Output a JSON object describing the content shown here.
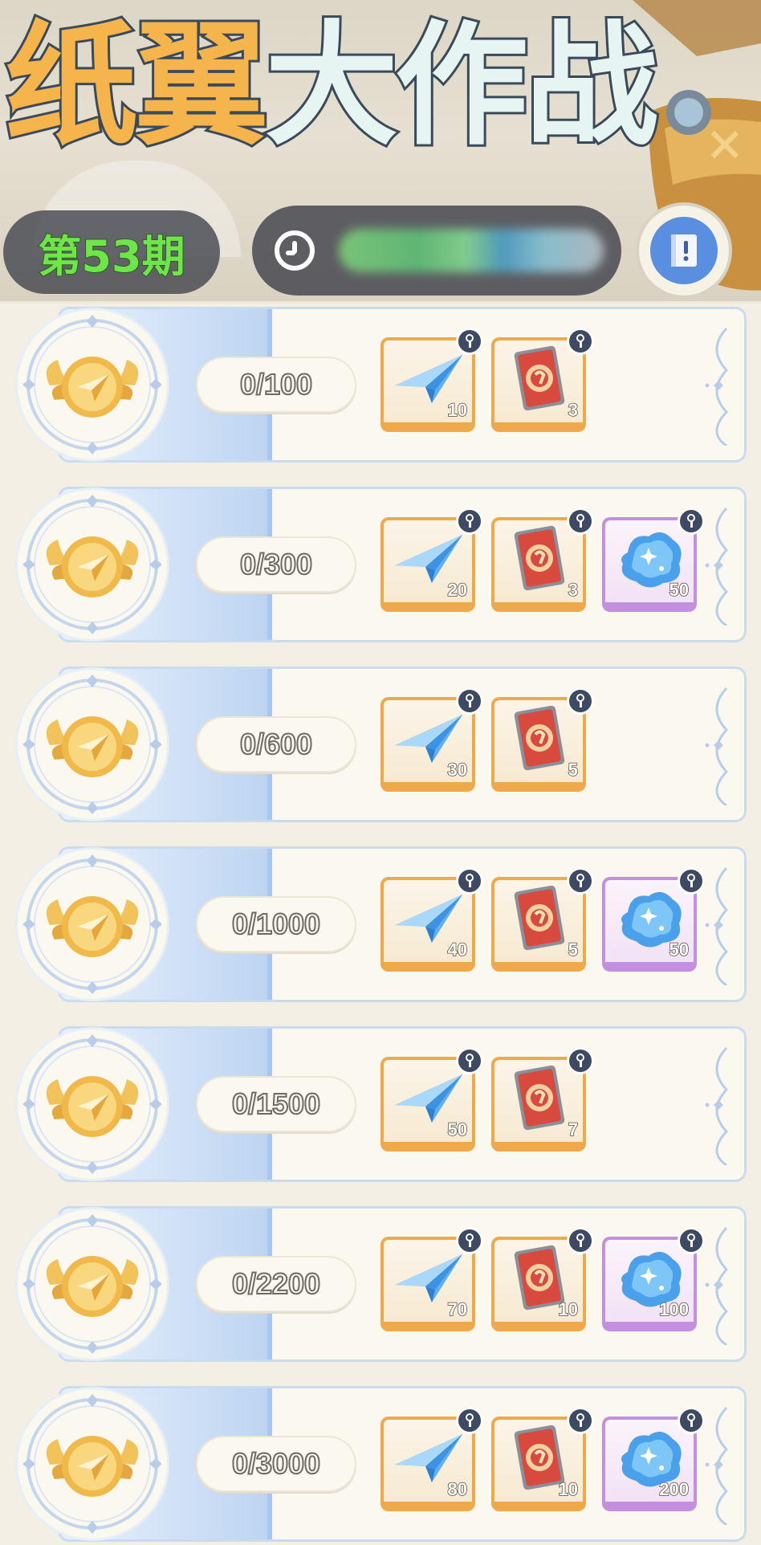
{
  "header": {
    "title_part1": "纸翼",
    "title_part2": "大作战",
    "period_label": "第53期",
    "timer_text": "",
    "colors": {
      "title_gold": "#f6b44c",
      "title_mint": "#e6f5f2",
      "period_green": "#6ee64a"
    }
  },
  "icons": {
    "clock": "clock-icon",
    "info": "rulebook-icon",
    "medal": "winged-coin-icon",
    "plane": "paper-plane-icon",
    "card": "red-card-icon",
    "gem": "blue-crystal-icon"
  },
  "tiers": [
    {
      "progress": "0/100",
      "rewards": [
        {
          "type": "plane",
          "qty": "10",
          "frame": "orange"
        },
        {
          "type": "card",
          "qty": "3",
          "frame": "orange"
        }
      ]
    },
    {
      "progress": "0/300",
      "rewards": [
        {
          "type": "plane",
          "qty": "20",
          "frame": "orange"
        },
        {
          "type": "card",
          "qty": "3",
          "frame": "orange"
        },
        {
          "type": "gem",
          "qty": "50",
          "frame": "purple"
        }
      ]
    },
    {
      "progress": "0/600",
      "rewards": [
        {
          "type": "plane",
          "qty": "30",
          "frame": "orange"
        },
        {
          "type": "card",
          "qty": "5",
          "frame": "orange"
        }
      ]
    },
    {
      "progress": "0/1000",
      "rewards": [
        {
          "type": "plane",
          "qty": "40",
          "frame": "orange"
        },
        {
          "type": "card",
          "qty": "5",
          "frame": "orange"
        },
        {
          "type": "gem",
          "qty": "50",
          "frame": "purple"
        }
      ]
    },
    {
      "progress": "0/1500",
      "rewards": [
        {
          "type": "plane",
          "qty": "50",
          "frame": "orange"
        },
        {
          "type": "card",
          "qty": "7",
          "frame": "orange"
        }
      ]
    },
    {
      "progress": "0/2200",
      "rewards": [
        {
          "type": "plane",
          "qty": "70",
          "frame": "orange"
        },
        {
          "type": "card",
          "qty": "10",
          "frame": "orange"
        },
        {
          "type": "gem",
          "qty": "100",
          "frame": "purple"
        }
      ]
    },
    {
      "progress": "0/3000",
      "rewards": [
        {
          "type": "plane",
          "qty": "80",
          "frame": "orange"
        },
        {
          "type": "card",
          "qty": "10",
          "frame": "orange"
        },
        {
          "type": "gem",
          "qty": "200",
          "frame": "purple"
        }
      ]
    }
  ]
}
